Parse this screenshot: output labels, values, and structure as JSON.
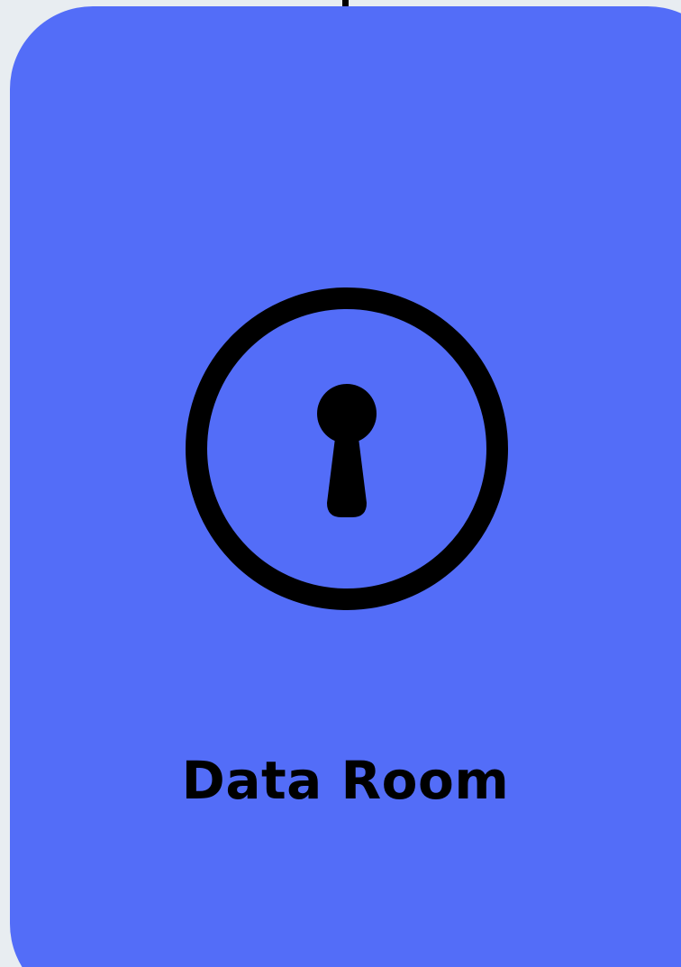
{
  "card": {
    "title": "Data Room",
    "icon": "keyhole-lock-icon",
    "background_color": "#536df8",
    "page_background_color": "#e8edf1"
  }
}
